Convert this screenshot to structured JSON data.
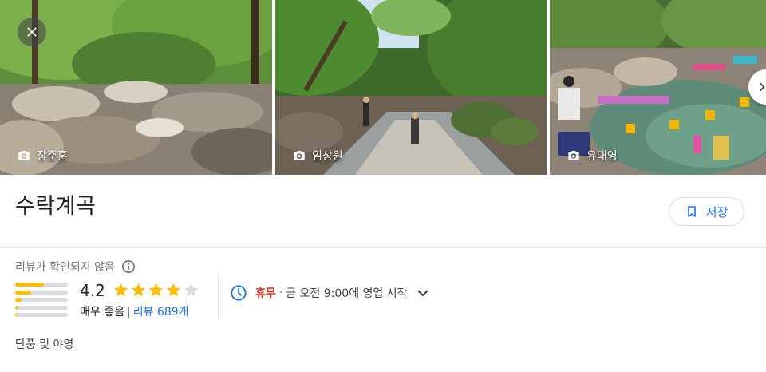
{
  "photos": [
    {
      "author": "장준훈"
    },
    {
      "author": "임상원"
    },
    {
      "author": "유대영"
    }
  ],
  "place": {
    "name": "수락계곡",
    "save_label": "저장"
  },
  "reviews": {
    "unverified_note": "리뷰가 확인되지 않음",
    "rating": "4.2",
    "rating_value": 4.2,
    "rating_word": "매우 좋음",
    "count_label": "리뷰 689개",
    "distribution": [
      0.55,
      0.3,
      0.12,
      0.05,
      0.03
    ]
  },
  "hours": {
    "status": "휴무",
    "dot": "·",
    "next_open": "금 오전 9:00에 영업 시작"
  },
  "category": "단풍 및 야영",
  "colors": {
    "accent": "#1a73e8",
    "star": "#fbbc04",
    "closed": "#d93025"
  },
  "icons": {
    "close": "close-icon",
    "next": "chevron-right-icon",
    "camera": "camera-icon",
    "bookmark": "bookmark-icon",
    "info": "info-icon",
    "clock": "clock-icon",
    "expand": "chevron-down-icon",
    "star": "star-icon"
  }
}
